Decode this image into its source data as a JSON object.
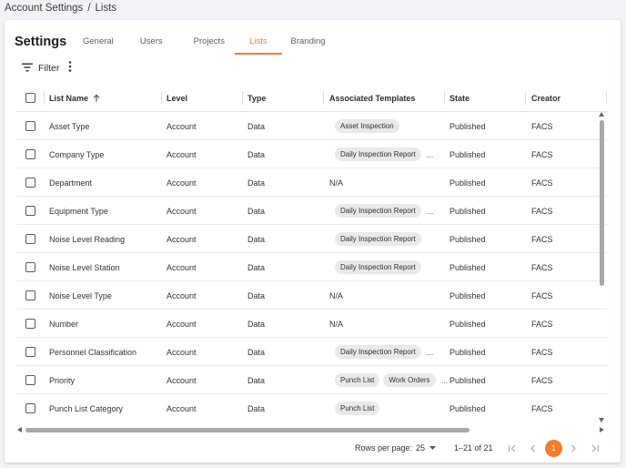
{
  "breadcrumb": {
    "parent": "Account Settings",
    "separator": "/",
    "current": "Lists"
  },
  "header": {
    "title": "Settings"
  },
  "tabs": [
    {
      "label": "General"
    },
    {
      "label": "Users"
    },
    {
      "label": "Projects"
    },
    {
      "label": "Lists"
    },
    {
      "label": "Branding"
    }
  ],
  "active_tab": "Lists",
  "accent_color": "#f47c2a",
  "toolbar": {
    "filter_label": "Filter",
    "filter_icon": "filter-list-icon",
    "more_icon": "more-vert-icon"
  },
  "table": {
    "columns": {
      "name": "List Name",
      "level": "Level",
      "type": "Type",
      "templates": "Associated Templates",
      "state": "State",
      "creator": "Creator"
    },
    "sort_icon": "arrow-up-icon",
    "rows": [
      {
        "name": "Asset Type",
        "level": "Account",
        "type": "Data",
        "templates_text": "",
        "chips": [
          "Asset Inspection"
        ],
        "more": "",
        "state": "Published",
        "creator": "FACS"
      },
      {
        "name": "Company Type",
        "level": "Account",
        "type": "Data",
        "templates_text": "",
        "chips": [
          "Daily Inspection Report"
        ],
        "more": "...",
        "state": "Published",
        "creator": "FACS"
      },
      {
        "name": "Department",
        "level": "Account",
        "type": "Data",
        "templates_text": "N/A",
        "chips": [],
        "more": "",
        "state": "Published",
        "creator": "FACS"
      },
      {
        "name": "Equipment Type",
        "level": "Account",
        "type": "Data",
        "templates_text": "",
        "chips": [
          "Daily Inspection Report"
        ],
        "more": "...",
        "state": "Published",
        "creator": "FACS"
      },
      {
        "name": "Noise Level Reading",
        "level": "Account",
        "type": "Data",
        "templates_text": "",
        "chips": [
          "Daily Inspection Report"
        ],
        "more": "",
        "state": "Published",
        "creator": "FACS"
      },
      {
        "name": "Noise Level Station",
        "level": "Account",
        "type": "Data",
        "templates_text": "",
        "chips": [
          "Daily Inspection Report"
        ],
        "more": "",
        "state": "Published",
        "creator": "FACS"
      },
      {
        "name": "Noise Level Type",
        "level": "Account",
        "type": "Data",
        "templates_text": "N/A",
        "chips": [],
        "more": "",
        "state": "Published",
        "creator": "FACS"
      },
      {
        "name": "Number",
        "level": "Account",
        "type": "Data",
        "templates_text": "N/A",
        "chips": [],
        "more": "",
        "state": "Published",
        "creator": "FACS"
      },
      {
        "name": "Personnel Classification",
        "level": "Account",
        "type": "Data",
        "templates_text": "",
        "chips": [
          "Daily Inspection Report"
        ],
        "more": "...",
        "state": "Published",
        "creator": "FACS"
      },
      {
        "name": "Priority",
        "level": "Account",
        "type": "Data",
        "templates_text": "",
        "chips": [
          "Punch List",
          "Work Orders"
        ],
        "more": "...",
        "state": "Published",
        "creator": "FACS"
      },
      {
        "name": "Punch List Category",
        "level": "Account",
        "type": "Data",
        "templates_text": "",
        "chips": [
          "Punch List"
        ],
        "more": "",
        "state": "Published",
        "creator": "FACS"
      }
    ]
  },
  "pagination": {
    "rows_per_page_label": "Rows per page:",
    "rows_per_page_value": "25",
    "range": "1–21 of 21",
    "current_page": "1",
    "icons": [
      "first-page-icon",
      "chevron-left-icon",
      "chevron-right-icon",
      "last-page-icon"
    ]
  }
}
